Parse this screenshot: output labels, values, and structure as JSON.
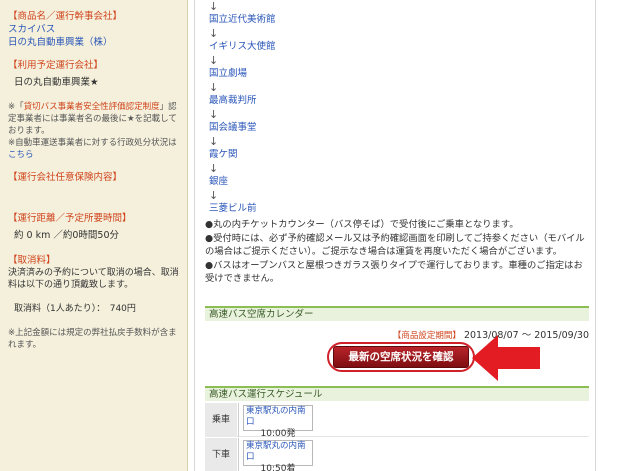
{
  "sidebar": {
    "product_title": "【商品名／運行幹事会社】",
    "product_name": "スカイバス",
    "product_company": "日の丸自動車興業（株）",
    "operator_title": "【利用予定運行会社】",
    "operator_name": "日の丸自動車興業★",
    "cert_note_prefix": "※「",
    "cert_note_link": "貸切バス事業者安全性評価認定制度",
    "cert_note_rest": "」認定事業者には事業者名の最後に★を記載しております。",
    "admin_note_text": "※自動車運送事業者に対する行政処分状況は",
    "admin_note_link": "こちら",
    "insurance_title": "【運行会社任意保険内容】",
    "distance_title": "【運行距離／予定所要時間】",
    "distance_value": "約 0 km ／約0時間50分",
    "cancel_title": "【取消料】",
    "cancel_desc": "決済済みの予約について取消の場合、取消料は以下の通り頂戴致します。",
    "cancel_fee": "取消料（1人あたり）：　740円",
    "cancel_note": "※上記金額には規定の弊社払戻手数料が含まれます。"
  },
  "route": {
    "arrow": "↓",
    "stops": [
      "国立近代美術館",
      "イギリス大使館",
      "国立劇場",
      "最高裁判所",
      "国会議事堂",
      "霞ケ関",
      "銀座",
      "三菱ビル前"
    ]
  },
  "notes": {
    "line1": "●丸の内チケットカウンター（バス停そば）で受付後にご乗車となります。",
    "line2": "●受付時には、必ず予約確認メール又は予約確認画面を印刷してご持参ください（モバイルの場合はご提示ください）。ご提示なき場合は運賃を再度いただく場合がございます。",
    "line3": "●バスはオープンバスと屋根つきガラス張りタイプで運行しております。車種のご指定はお受けできません。"
  },
  "calendar": {
    "heading": "高速バス空席カレンダー",
    "period_label": "【商品設定期間】",
    "period_value": "2013/08/07 ～ 2015/09/30",
    "button_label": "最新の空席状況を確認"
  },
  "schedule": {
    "heading": "高速バス運行スケジュール",
    "board_label": "乗車",
    "board_stop": "東京駅丸の内南口",
    "board_time": "10:00発",
    "alight_label": "下車",
    "alight_stop": "東京駅丸の内南口",
    "alight_time": "10:50着"
  },
  "colors": {
    "accent_red": "#d0431c",
    "link_blue": "#2a56b8",
    "header_green": "#8bbf55",
    "button_red": "#9a1a1f",
    "arrow_red": "#e31b23"
  }
}
